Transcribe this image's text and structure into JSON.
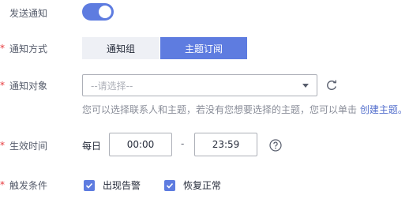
{
  "colors": {
    "primary": "#5e7ce0",
    "required": "#e6383c",
    "link": "#526ecc",
    "hint": "#8a8e99"
  },
  "send_notification": {
    "label": "发送通知",
    "enabled": true
  },
  "notify_method": {
    "required_mark": "*",
    "label": "通知方式",
    "options": [
      "通知组",
      "主题订阅"
    ],
    "selected": "主题订阅"
  },
  "notify_target": {
    "required_mark": "*",
    "label": "通知对象",
    "placeholder": "--请选择--",
    "hint_text": "您可以选择联系人和主题，若没有您想要选择的主题，您可以单击",
    "hint_link": "创建主题。",
    "refresh_icon": "refresh-icon",
    "arrow_icon": "caret-down-icon"
  },
  "effective_time": {
    "required_mark": "*",
    "label": "生效时间",
    "prefix": "每日",
    "start": "00:00",
    "separator": "-",
    "end": "23:59",
    "help_icon": "question-circle-icon"
  },
  "trigger": {
    "required_mark": "*",
    "label": "触发条件",
    "options": [
      {
        "label": "出现告警",
        "checked": true
      },
      {
        "label": "恢复正常",
        "checked": true
      }
    ]
  }
}
